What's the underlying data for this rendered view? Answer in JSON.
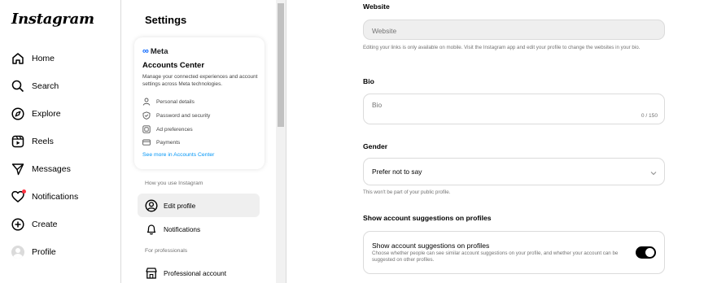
{
  "nav": {
    "logo": "Instagram",
    "items": [
      {
        "label": "Home",
        "icon": "home-icon"
      },
      {
        "label": "Search",
        "icon": "search-icon"
      },
      {
        "label": "Explore",
        "icon": "compass-icon"
      },
      {
        "label": "Reels",
        "icon": "reels-icon"
      },
      {
        "label": "Messages",
        "icon": "send-icon"
      },
      {
        "label": "Notifications",
        "icon": "heart-icon"
      },
      {
        "label": "Create",
        "icon": "plus-square-icon"
      },
      {
        "label": "Profile",
        "icon": "avatar"
      }
    ]
  },
  "settings": {
    "title": "Settings",
    "accounts_center": {
      "brand": "Meta",
      "title": "Accounts Center",
      "description": "Manage your connected experiences and account settings across Meta technologies.",
      "items": [
        "Personal details",
        "Password and security",
        "Ad preferences",
        "Payments"
      ],
      "link": "See more in Accounts Center"
    },
    "section_how": "How you use Instagram",
    "edit_profile": "Edit profile",
    "notifications": "Notifications",
    "section_pro": "For professionals",
    "professional_account": "Professional account"
  },
  "form": {
    "website_label": "Website",
    "website_placeholder": "Website",
    "website_hint": "Editing your links is only available on mobile. Visit the Instagram app and edit your profile to change the websites in your bio.",
    "bio_label": "Bio",
    "bio_placeholder": "Bio",
    "bio_count": "0 / 150",
    "gender_label": "Gender",
    "gender_value": "Prefer not to say",
    "gender_hint": "This won't be part of your public profile.",
    "suggest_label": "Show account suggestions on profiles",
    "suggest_title": "Show account suggestions on profiles",
    "suggest_desc": "Choose whether people can see similar account suggestions on your profile, and whether your account can be suggested on other profiles.",
    "suggest_enabled": true
  },
  "colors": {
    "accent": "#0095f6",
    "meta_blue": "#0866ff",
    "notify": "#ff3040"
  }
}
